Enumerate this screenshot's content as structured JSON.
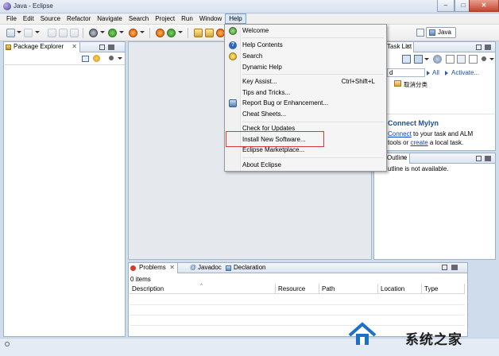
{
  "window": {
    "title": "Java - Eclipse"
  },
  "menubar": [
    "File",
    "Edit",
    "Source",
    "Refactor",
    "Navigate",
    "Search",
    "Project",
    "Run",
    "Window",
    "Help"
  ],
  "perspective": {
    "label": "Java"
  },
  "package_explorer": {
    "tab": "Package Explorer"
  },
  "task_list": {
    "tab": "Task List",
    "search_value": "d",
    "filter_all": "All",
    "filter_activate": "Activate...",
    "category": "取消分类",
    "connect_title": "Connect Mylyn",
    "connect_link": "Connect",
    "connect_text_1": " to your task and ALM",
    "connect_text_2": "tools or ",
    "create_link": "create",
    "connect_text_3": " a local task."
  },
  "outline": {
    "tab": "Outline",
    "message": "utline is not available."
  },
  "help_menu": {
    "items": [
      {
        "label": "Welcome",
        "icon": "eclipse-welcome-icon"
      },
      {
        "label": "Help Contents",
        "icon": "help-contents-icon"
      },
      {
        "label": "Search",
        "icon": "help-search-icon"
      },
      {
        "label": "Dynamic Help",
        "icon": ""
      },
      {
        "label": "Key Assist...",
        "shortcut": "Ctrl+Shift+L"
      },
      {
        "label": "Tips and Tricks..."
      },
      {
        "label": "Report Bug or Enhancement...",
        "icon": "bug-report-icon"
      },
      {
        "label": "Cheat Sheets..."
      },
      {
        "label": "Check for Updates"
      },
      {
        "label": "Install New Software..."
      },
      {
        "label": "Eclipse Marketplace..."
      },
      {
        "label": "About Eclipse"
      }
    ]
  },
  "bottom_tabs": {
    "problems": "Problems",
    "javadoc": "Javadoc",
    "declaration": "Declaration"
  },
  "problems": {
    "count": "0 items",
    "columns": [
      "Description",
      "Resource",
      "Path",
      "Location",
      "Type"
    ]
  },
  "watermark": {
    "text": "系统之家"
  },
  "colors": {
    "accent": "#0a43c9",
    "highlight": "#d33a3a"
  }
}
